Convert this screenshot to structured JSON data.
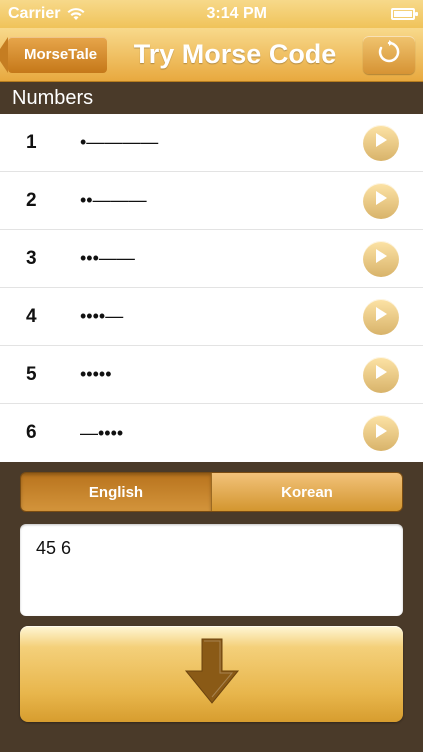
{
  "status_bar": {
    "carrier": "Carrier",
    "time": "3:14 PM"
  },
  "nav": {
    "back_label": "MorseTale",
    "title": "Try Morse Code"
  },
  "section": {
    "title": "Numbers"
  },
  "rows": [
    {
      "label": "1",
      "code": "•————"
    },
    {
      "label": "2",
      "code": "••———"
    },
    {
      "label": "3",
      "code": "•••——"
    },
    {
      "label": "4",
      "code": "••••—"
    },
    {
      "label": "5",
      "code": "•••••"
    },
    {
      "label": "6",
      "code": "—••••"
    }
  ],
  "language_toggle": {
    "options": [
      "English",
      "Korean"
    ],
    "selected": "English"
  },
  "input": {
    "value": "45 6"
  },
  "icons": {
    "wifi": "wifi-icon",
    "battery": "battery-icon",
    "refresh": "refresh-icon",
    "play": "play-icon",
    "convert": "down-arrow-icon"
  },
  "colors": {
    "accent": "#e8a93f",
    "background": "#4a3a29"
  }
}
